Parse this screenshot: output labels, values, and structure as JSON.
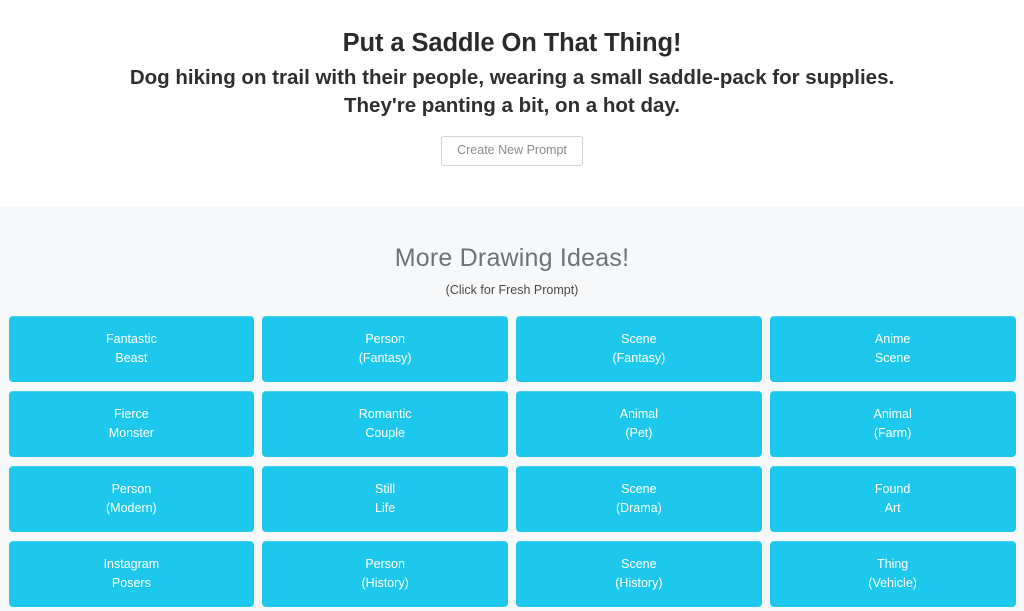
{
  "hero": {
    "title": "Put a Saddle On That Thing!",
    "description_line1": "Dog hiking on trail with their people, wearing a small saddle-pack for supplies.",
    "description_line2": "They're panting a bit, on a hot day.",
    "new_prompt_label": "Create New Prompt"
  },
  "ideas": {
    "title": "More Drawing Ideas!",
    "hint": "(Click for Fresh Prompt)",
    "buttons": [
      {
        "line1": "Fantastic",
        "line2": "Beast"
      },
      {
        "line1": "Person",
        "line2": "(Fantasy)"
      },
      {
        "line1": "Scene",
        "line2": "(Fantasy)"
      },
      {
        "line1": "Anime",
        "line2": "Scene"
      },
      {
        "line1": "Fierce",
        "line2": "Monster"
      },
      {
        "line1": "Romantic",
        "line2": "Couple"
      },
      {
        "line1": "Animal",
        "line2": "(Pet)"
      },
      {
        "line1": "Animal",
        "line2": "(Farm)"
      },
      {
        "line1": "Person",
        "line2": "(Modern)"
      },
      {
        "line1": "Still",
        "line2": "Life"
      },
      {
        "line1": "Scene",
        "line2": "(Drama)"
      },
      {
        "line1": "Found",
        "line2": "Art"
      },
      {
        "line1": "Instagram",
        "line2": "Posers"
      },
      {
        "line1": "Person",
        "line2": "(History)"
      },
      {
        "line1": "Scene",
        "line2": "(History)"
      },
      {
        "line1": "Thing",
        "line2": "(Vehicle)"
      }
    ]
  },
  "colors": {
    "idea_button_bg": "#1ec8ec",
    "idea_button_text": "#ffffff",
    "section_bg": "#f7f8fa",
    "hero_bg": "#ffffff",
    "heading_text": "#2b2b2b",
    "ideas_heading_text": "#6f7276",
    "new_prompt_border": "#d6d6d6",
    "new_prompt_text": "#8d8d8d"
  }
}
